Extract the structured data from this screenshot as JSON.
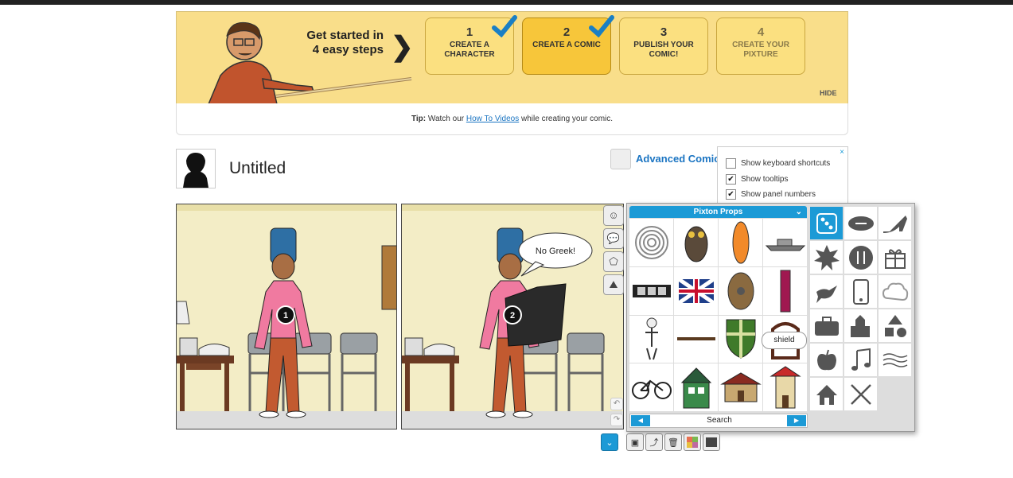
{
  "banner": {
    "get_started": "Get started in 4 easy steps",
    "steps": [
      {
        "num": "1",
        "label": "CREATE A CHARACTER",
        "done": true
      },
      {
        "num": "2",
        "label": "CREATE A COMIC",
        "done": true
      },
      {
        "num": "3",
        "label": "PUBLISH YOUR COMIC!",
        "done": false
      },
      {
        "num": "4",
        "label": "CREATE YOUR PIXTURE",
        "done": false
      }
    ],
    "hide_label": "HIDE",
    "tip_prefix": "Tip:",
    "tip_text_before": "Watch our",
    "tip_link": "How To Videos",
    "tip_text_after": "while creating your comic."
  },
  "comic": {
    "title": "Untitled",
    "panel_numbers": [
      "1",
      "2"
    ],
    "speech_bubble": "No Greek!"
  },
  "advanced": {
    "link_label": "Advanced Comic",
    "close": "×",
    "options": [
      {
        "label": "Show keyboard shortcuts",
        "checked": false
      },
      {
        "label": "Show tooltips",
        "checked": true
      },
      {
        "label": "Show panel numbers",
        "checked": true
      }
    ]
  },
  "props": {
    "header": "Pixton Props",
    "search_label": "Search",
    "prev": "◀",
    "next": "▶",
    "tooltip": "shield",
    "items": [
      "spiral",
      "owl",
      "surfboard",
      "battleship",
      "film-strip",
      "uk-flag",
      "round-shield",
      "pillar",
      "skeleton",
      "stick",
      "knight-shield",
      "mirror-frame",
      "bicycle",
      "green-house",
      "red-house",
      "pagoda-house"
    ],
    "categories": [
      "dice",
      "football",
      "high-heel",
      "explosion",
      "cutlery",
      "gift",
      "bird",
      "phone",
      "cloud",
      "briefcase",
      "city",
      "shapes",
      "apple",
      "music-note",
      "water",
      "house",
      "swords"
    ]
  },
  "colors": {
    "accent": "#1c9ad6",
    "banner": "#f9de8a",
    "step_active": "#f7c63a"
  }
}
